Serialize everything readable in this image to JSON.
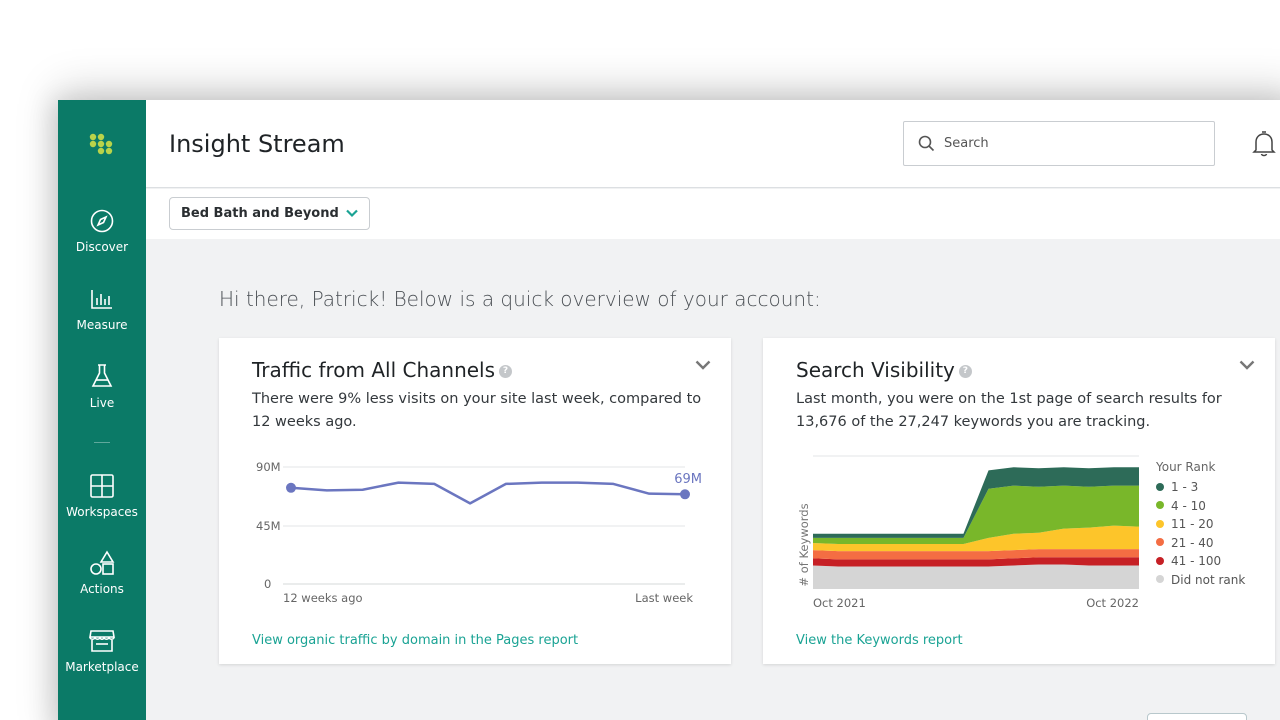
{
  "app": {
    "title": "Insight Stream"
  },
  "sidebar": {
    "items": [
      {
        "label": "Discover",
        "icon": "compass-icon"
      },
      {
        "label": "Measure",
        "icon": "bar-chart-icon"
      },
      {
        "label": "Live",
        "icon": "flask-icon"
      },
      {
        "label": "Workspaces",
        "icon": "grid-icon"
      },
      {
        "label": "Actions",
        "icon": "shapes-icon"
      },
      {
        "label": "Marketplace",
        "icon": "storefront-icon"
      }
    ]
  },
  "search": {
    "placeholder": "Search"
  },
  "account": {
    "selected": "Bed Bath and Beyond"
  },
  "greeting": "Hi there, Patrick! Below is a quick overview of your account:",
  "traffic_card": {
    "title": "Traffic from All Channels",
    "description": "There were 9% less visits on your site last week, compared to 12 weeks ago.",
    "link": "View organic traffic by domain in the Pages report"
  },
  "visibility_card": {
    "title": "Search Visibility",
    "description": "Last month, you were on the 1st page of search results for 13,676 of the 27,247 keywords you are tracking.",
    "link": "View the Keywords report",
    "legend_title": "Your Rank"
  },
  "colors": {
    "sidebar": "#0b7a67",
    "accent": "#1aa394",
    "line": "#6b76c0"
  },
  "chart_data": [
    {
      "type": "line",
      "x_labels": [
        "12 weeks ago",
        "Last week"
      ],
      "y_ticks": [
        "90M",
        "45M",
        "0"
      ],
      "ylim": [
        0,
        90
      ],
      "unit": "M",
      "values": [
        74,
        72,
        72.5,
        78,
        77,
        62,
        77,
        78,
        78,
        77,
        69.5,
        69
      ],
      "end_label": "69M",
      "color": "#6b76c0"
    },
    {
      "type": "area",
      "ylabel": "# of Keywords",
      "x_labels": [
        "Oct 2021",
        "Oct 2022"
      ],
      "points": 14,
      "series": [
        {
          "name": "Did not rank",
          "color": "#d5d5d5",
          "values": [
            23,
            22,
            22,
            22,
            22,
            22,
            22,
            22,
            23,
            24,
            24,
            23,
            23,
            23
          ]
        },
        {
          "name": "41 - 100",
          "color": "#c62025",
          "values": [
            7,
            7,
            7,
            7,
            7,
            7,
            7,
            7,
            7,
            7,
            7,
            8,
            8,
            8
          ]
        },
        {
          "name": "21 - 40",
          "color": "#f46d43",
          "values": [
            8,
            8,
            8,
            8,
            8,
            8,
            8,
            8,
            8,
            8,
            8,
            8,
            8,
            8
          ]
        },
        {
          "name": "11 - 20",
          "color": "#fdc52a",
          "values": [
            7,
            7,
            7,
            7,
            7,
            7,
            7,
            13,
            16,
            16,
            20,
            21,
            23,
            22
          ]
        },
        {
          "name": "4 - 10",
          "color": "#79b72a",
          "values": [
            5,
            6,
            6,
            6,
            6,
            6,
            6,
            48,
            47,
            45,
            42,
            40,
            39,
            40
          ]
        },
        {
          "name": "1 - 3",
          "color": "#2d6b58",
          "values": [
            4,
            4,
            4,
            4,
            4,
            4,
            4,
            18,
            18,
            18,
            18,
            18,
            18,
            18
          ]
        }
      ]
    }
  ]
}
